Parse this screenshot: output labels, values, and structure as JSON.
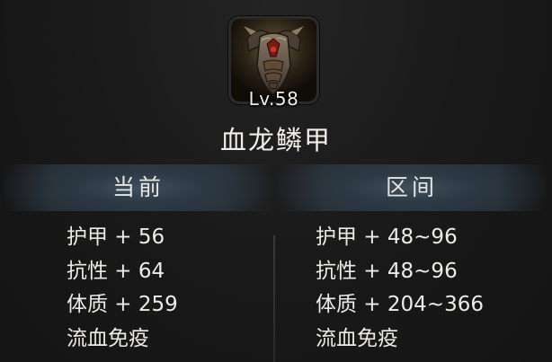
{
  "item": {
    "level": "Lv.58",
    "name": "血龙鳞甲",
    "icon": "dragon-scale-armor-icon",
    "frame_color": "#c9a21f"
  },
  "sections": {
    "current": {
      "title": "当前",
      "stats": [
        "护甲 + 56",
        "抗性 + 64",
        "体质 + 259",
        "流血免疫"
      ]
    },
    "range": {
      "title": "区间",
      "stats": [
        "护甲 + 48~96",
        "抗性 + 48~96",
        "体质 + 204~366",
        "流血免疫"
      ]
    }
  },
  "colors": {
    "background": "#181818",
    "header_tint": "#3c5062",
    "text": "#ecebe6"
  }
}
